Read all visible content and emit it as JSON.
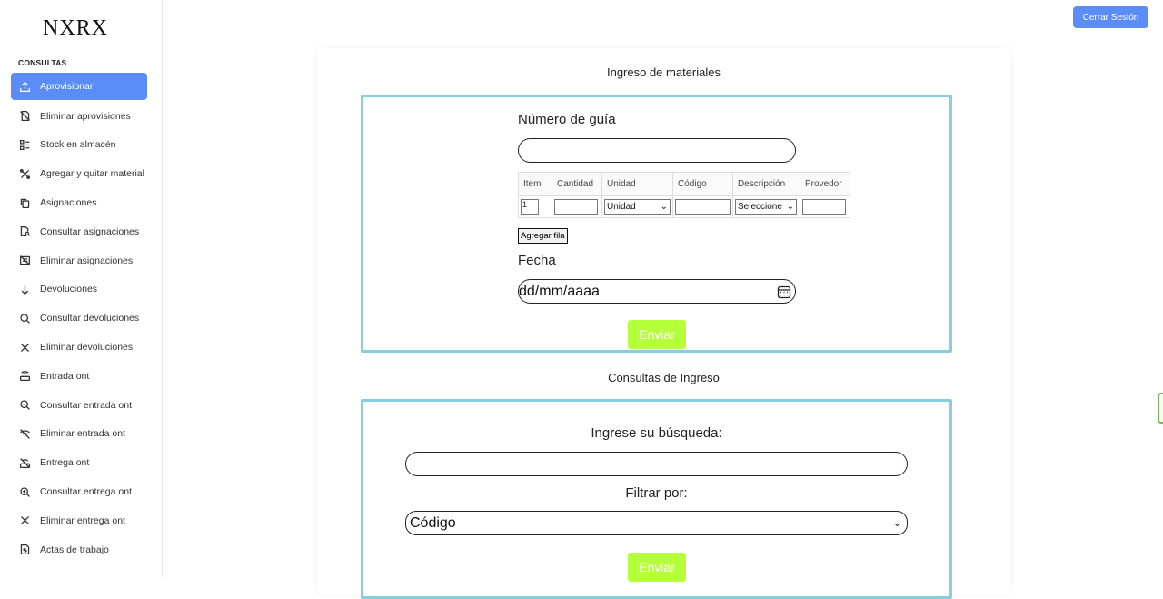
{
  "brand": "NXRX",
  "sidebar": {
    "section": "CONSULTAS",
    "items": [
      {
        "label": "Aprovisionar",
        "icon": "upload-icon",
        "active": true
      },
      {
        "label": "Eliminar aprovisiones",
        "icon": "file-off-icon"
      },
      {
        "label": "Stock en almacén",
        "icon": "list-check-icon"
      },
      {
        "label": "Agregar y quitar material",
        "icon": "tools-icon"
      },
      {
        "label": "Asignaciones",
        "icon": "copy-icon"
      },
      {
        "label": "Consultar asignaciones",
        "icon": "file-search-icon"
      },
      {
        "label": "Eliminar asignaciones",
        "icon": "list-off-icon"
      },
      {
        "label": "Devoluciones",
        "icon": "arrow-down-icon"
      },
      {
        "label": "Consultar devoluciones",
        "icon": "search-icon"
      },
      {
        "label": "Eliminar devoluciones",
        "icon": "close-icon"
      },
      {
        "label": "Entrada ont",
        "icon": "router-icon"
      },
      {
        "label": "Consultar entrada ont",
        "icon": "zoom-search-icon"
      },
      {
        "label": "Eliminar entrada ont",
        "icon": "wifi-off-icon"
      },
      {
        "label": "Entrega ont",
        "icon": "router-off-icon"
      },
      {
        "label": "Consultar entrega ont",
        "icon": "zoom-in-icon"
      },
      {
        "label": "Eliminar entrega ont",
        "icon": "close-icon"
      },
      {
        "label": "Actas de trabajo",
        "icon": "file-dollar-icon"
      }
    ]
  },
  "header": {
    "logout_label": "Cerrar Sesión"
  },
  "ingreso": {
    "title": "Ingreso de materiales",
    "guia_label": "Número de guía",
    "guia_value": "",
    "table": {
      "headers": [
        "Item",
        "Cantidad",
        "Unidad",
        "Código",
        "Descripción",
        "Provedor"
      ],
      "row": {
        "item": "1",
        "cantidad": "",
        "unidad": "Unidad",
        "codigo": "",
        "descripcion": "Seleccione",
        "provedor": ""
      }
    },
    "add_row_label": "Agregar fila",
    "fecha_label": "Fecha",
    "fecha_placeholder": "dd/mm/aaaa",
    "submit_label": "Enviar"
  },
  "consultas": {
    "title": "Consultas de Ingreso",
    "search_label": "Ingrese su búsqueda:",
    "search_value": "",
    "filter_label": "Filtrar por:",
    "filter_value": "Código",
    "submit_label": "Enviar"
  },
  "colors": {
    "accent": "#5b8df6",
    "frame": "#86cfe0",
    "submit": "#b6ff3b"
  }
}
